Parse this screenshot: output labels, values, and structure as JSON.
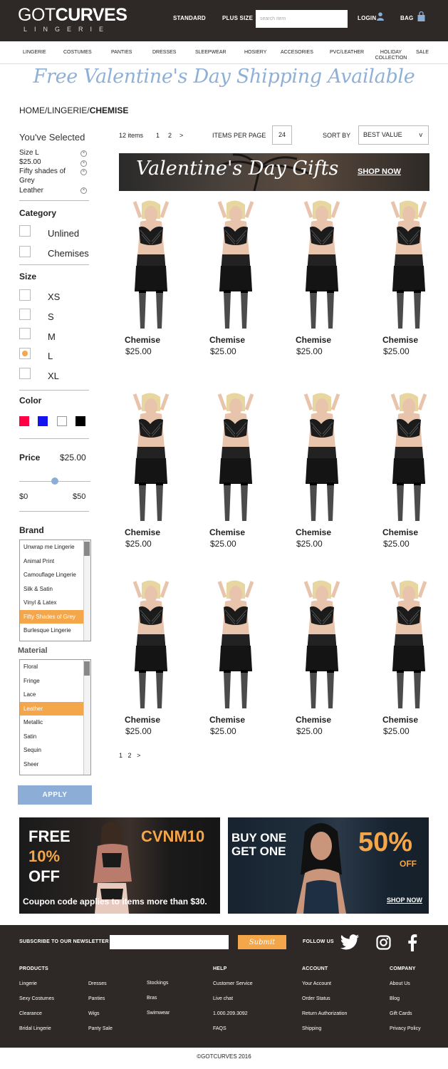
{
  "header": {
    "logo_part1": "GOT",
    "logo_part2": "CURVES",
    "logo_sub": "LINGERIE",
    "nav": [
      "STANDARD",
      "PLUS SIZE"
    ],
    "search_placeholder": "search item",
    "login": "LOGIN",
    "bag": "BAG"
  },
  "categories": [
    "LINGERIE",
    "COSTUMES",
    "PANTIES",
    "DRESSES",
    "SLEEPWEAR",
    "HOSIERY",
    "ACCESORIES",
    "PVC/LEATHER",
    "HOLIDAY",
    "COLLECTION",
    "SALE"
  ],
  "promo_banner": "Free Valentine's Day Shipping Available",
  "breadcrumb": {
    "path": "HOME/LINGERIE/",
    "current": "CHEMISE"
  },
  "sidebar": {
    "selected_title": "You've Selected",
    "selected": [
      "Size L",
      "$25.00",
      "Fifty shades of",
      "Grey",
      "Leather"
    ],
    "category_title": "Category",
    "category_options": [
      "Unlined",
      "Chemises"
    ],
    "size_title": "Size",
    "sizes": [
      "XS",
      "S",
      "M",
      "L",
      "XL"
    ],
    "size_selected": "L",
    "color_title": "Color",
    "colors": [
      "#ff0044",
      "#1414f0",
      "#ffffff",
      "#000000"
    ],
    "price_title": "Price",
    "price_value": "$25.00",
    "price_min": "$0",
    "price_max": "$50",
    "price_fraction": 0.5,
    "brand_title": "Brand",
    "brands": [
      "Unwrap me Lingerie",
      "Animal Print",
      "Camouflage Lingerie",
      "Silk & Satin",
      "Vinyl & Latex",
      "Fifty Shades of Grey",
      "Burlesque Lingerie"
    ],
    "brand_selected": "Fifty Shades of Grey",
    "material_title": "Material",
    "materials": [
      "Floral",
      "Fringe",
      "Lace",
      "Leather",
      "Metallic",
      "Satin",
      "Sequin",
      "Sheer"
    ],
    "material_selected": "Leather",
    "apply": "APPLY"
  },
  "toolbar": {
    "count": "12 items",
    "pages": [
      "1",
      "2",
      ">"
    ],
    "per_page_label": "ITEMS PER PAGE",
    "per_page": "24",
    "sort_label": "SORT BY",
    "sort_value": "BEST VALUE",
    "sort_caret": "v"
  },
  "gift_banner": {
    "title": "Valentine's Day Gifts",
    "cta": "SHOP NOW"
  },
  "product": {
    "name": "Chemise",
    "price": "$25.00"
  },
  "bottom_pager": [
    "1",
    "2",
    ">"
  ],
  "promos": {
    "left": {
      "l1": "FREE",
      "l2": "10%",
      "l3": "OFF",
      "code": "CVNM10",
      "note": "Coupon code applies to items more than $30."
    },
    "right": {
      "l1": "BUY ONE",
      "l2": "GET ONE",
      "pct": "50%",
      "off": "OFF",
      "cta": "SHOP NOW"
    }
  },
  "footer": {
    "newsletter": "SUBSCRIBE TO OUR NEWSLETTER",
    "submit": "Submit",
    "follow": "FOLLOW US",
    "products_title": "PRODUCTS",
    "products_col1": [
      "Lingerie",
      "Sexy Costumes",
      "Clearance",
      "Bridal Lingerie"
    ],
    "products_col2": [
      "Dresses",
      "Panties",
      "Wigs",
      "Panty Sale"
    ],
    "products_col3": [
      "Stockings",
      "Bras",
      "Swimwear"
    ],
    "help_title": "HELP",
    "help": [
      "Customer Service",
      "Live chat",
      "1.000.209.3092",
      "FAQS"
    ],
    "account_title": "ACCOUNT",
    "account": [
      "Your Account",
      "Order Status",
      "Return Authorization",
      "Shipping"
    ],
    "company_title": "COMPANY",
    "company": [
      "About Us",
      "Blog",
      "Gift Cards",
      "Privacy Policy"
    ],
    "copyright": "©GOTCURVES 2016"
  }
}
